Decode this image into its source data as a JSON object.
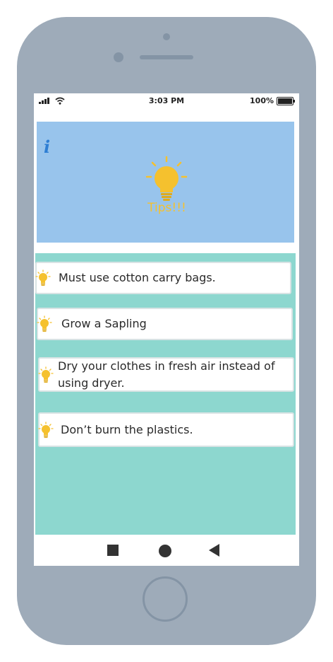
{
  "status_bar": {
    "time": "3:03 PM",
    "battery": "100%"
  },
  "header": {
    "info_icon": "i",
    "title": "Tips!!!"
  },
  "tips": [
    {
      "text": "Must use cotton carry bags.",
      "icon": "lightbulb-icon"
    },
    {
      "text": "Grow a Sapling",
      "icon": "lightbulb-icon"
    },
    {
      "text": "Dry your clothes in fresh air instead of using dryer.",
      "icon": "lightbulb-icon"
    },
    {
      "text": "Don’t burn the plastics.",
      "icon": "lightbulb-icon"
    }
  ],
  "colors": {
    "header_bg": "#98c4ec",
    "content_bg": "#8dd7cf",
    "accent_yellow": "#f5c12e",
    "info_blue": "#2e7ed3",
    "phone_frame": "#9eabb9"
  }
}
